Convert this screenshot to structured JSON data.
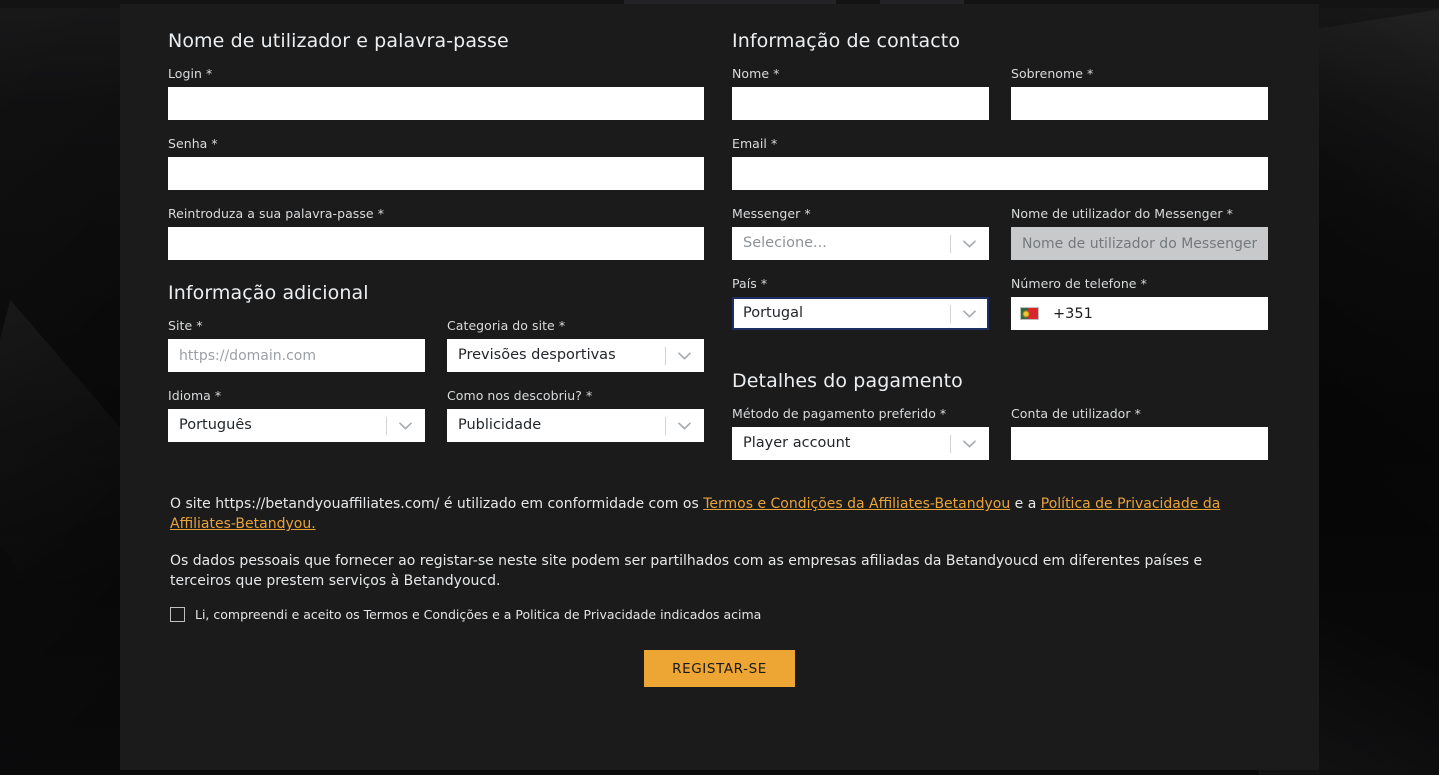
{
  "colors": {
    "accent": "#eda634",
    "link": "#e7a33a",
    "card_bg": "#1b1b1c",
    "page_bg": "#070707",
    "focus_border": "#1c2f5e",
    "disabled_bg": "#c7c9cb"
  },
  "sections": {
    "credentials_title": "Nome de utilizador e palavra-passe",
    "contact_title": "Informação de contacto",
    "additional_title": "Informação adicional",
    "payment_title": "Detalhes do pagamento"
  },
  "fields": {
    "login": {
      "label": "Login *",
      "value": "",
      "placeholder": ""
    },
    "password": {
      "label": "Senha *",
      "value": "",
      "placeholder": ""
    },
    "password_repeat": {
      "label": "Reintroduza a sua palavra-passe *",
      "value": "",
      "placeholder": ""
    },
    "first_name": {
      "label": "Nome *",
      "value": "",
      "placeholder": ""
    },
    "last_name": {
      "label": "Sobrenome *",
      "value": "",
      "placeholder": ""
    },
    "email": {
      "label": "Email *",
      "value": "",
      "placeholder": ""
    },
    "messenger": {
      "label": "Messenger *",
      "value": "Selecione...",
      "is_placeholder": true
    },
    "messenger_username": {
      "label": "Nome de utilizador do Messenger *",
      "value": "",
      "placeholder": "Nome de utilizador do Messenger",
      "disabled": true
    },
    "country": {
      "label": "País *",
      "value": "Portugal",
      "focused": true
    },
    "phone": {
      "label": "Número de telefone *",
      "value": "+351",
      "flag": "portugal-flag"
    },
    "site": {
      "label": "Site *",
      "value": "",
      "placeholder": "https://domain.com"
    },
    "site_category": {
      "label": "Categoria do site *",
      "value": "Previsões desportivas"
    },
    "language": {
      "label": "Idioma *",
      "value": "Português"
    },
    "how_found": {
      "label": "Como nos descobriu? *",
      "value": "Publicidade"
    },
    "payment_method": {
      "label": "Método de pagamento preferido *",
      "value": "Player account"
    },
    "user_account": {
      "label": "Conta de utilizador *",
      "value": "",
      "placeholder": ""
    }
  },
  "legal": {
    "para1_before": "O site https://betandyouaffiliates.com/ é utilizado em conformidade com os ",
    "link_terms": "Termos e Condições da Affiliates-Betandyou",
    "para1_middle": " e a ",
    "link_privacy": "Política de Privacidade da Affiliates-Betandyou.",
    "para2": "Os dados pessoais que fornecer ao registar-se neste site podem ser partilhados com as empresas afiliadas da Betandyoucd em diferentes países e terceiros que prestem serviços à Betandyoucd.",
    "consent_label": "Li, compreendi e aceito os Termos e Condições e a Politica de Privacidade indicados acima",
    "consent_checked": false
  },
  "actions": {
    "submit_label": "REGISTAR-SE"
  }
}
